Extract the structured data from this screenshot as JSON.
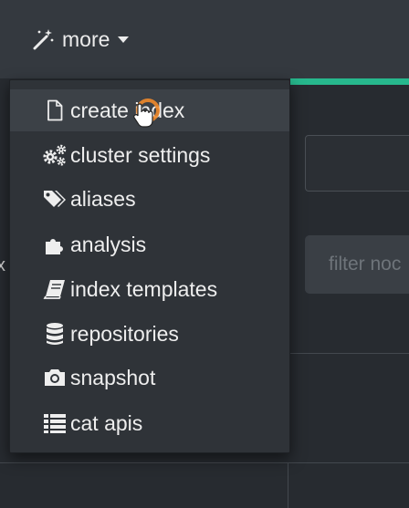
{
  "navbar": {
    "more_label": "more",
    "more_icon": "magic-wand-icon",
    "caret_icon": "caret-down-icon",
    "accent_color": "#27b88d"
  },
  "background": {
    "filter_placeholder": "filter noc",
    "partial_char": "x"
  },
  "menu": {
    "items": [
      {
        "label": "create index",
        "icon": "file-icon"
      },
      {
        "label": "cluster settings",
        "icon": "cogs-icon"
      },
      {
        "label": "aliases",
        "icon": "tags-icon"
      },
      {
        "label": "analysis",
        "icon": "puzzle-icon"
      },
      {
        "label": "index templates",
        "icon": "book-icon"
      },
      {
        "label": "repositories",
        "icon": "database-icon"
      },
      {
        "label": "snapshot",
        "icon": "camera-icon"
      },
      {
        "label": "cat apis",
        "icon": "list-icon"
      }
    ],
    "hovered_item": "create index"
  },
  "colors": {
    "page_bg": "#272b30",
    "navbar_bg": "#34393f",
    "menu_bg": "#2f3338",
    "menu_hover_bg": "#3c4147",
    "text": "#eeeeee",
    "cursor_ring": "#f0892b"
  }
}
